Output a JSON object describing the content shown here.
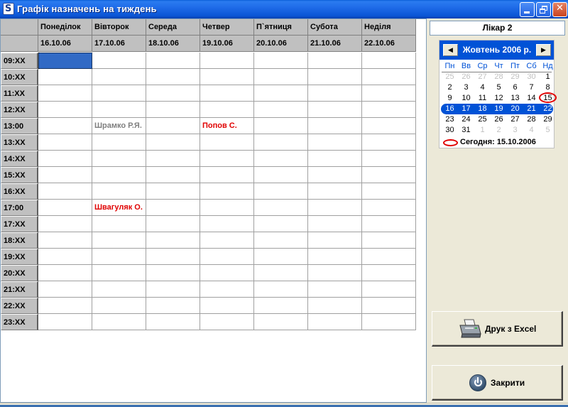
{
  "window": {
    "title": "Графік назначень на тиждень",
    "icon": "app-s-icon",
    "controls": [
      "minimize-icon",
      "restore-icon",
      "close-icon"
    ]
  },
  "grid": {
    "days": [
      {
        "name": "Понеділок",
        "date": "16.10.06"
      },
      {
        "name": "Вівторок",
        "date": "17.10.06"
      },
      {
        "name": "Середа",
        "date": "18.10.06"
      },
      {
        "name": "Четвер",
        "date": "19.10.06"
      },
      {
        "name": "П`ятниця",
        "date": "20.10.06"
      },
      {
        "name": "Субота",
        "date": "21.10.06"
      },
      {
        "name": "Неділя",
        "date": "22.10.06"
      }
    ],
    "times": [
      "09:XX",
      "10:XX",
      "11:XX",
      "12:XX",
      "13:00",
      "13:XX",
      "14:XX",
      "15:XX",
      "16:XX",
      "17:00",
      "17:XX",
      "18:XX",
      "19:XX",
      "20:XX",
      "21:XX",
      "22:XX",
      "23:XX"
    ],
    "appointments": [
      {
        "row": 4,
        "col": 1,
        "text": "Шрамко Р.Я.",
        "color": "gray"
      },
      {
        "row": 4,
        "col": 3,
        "text": "Попов С.",
        "color": "red"
      },
      {
        "row": 9,
        "col": 1,
        "text": "Швагуляк О.",
        "color": "red"
      }
    ],
    "selected": {
      "row": 0,
      "col": 0
    }
  },
  "doctor": {
    "label": "Лікар 2"
  },
  "calendar": {
    "month_label": "Жовтень 2006 р.",
    "weekdays": [
      "Пн",
      "Вв",
      "Ср",
      "Чт",
      "Пт",
      "Сб",
      "Нд"
    ],
    "weeks": [
      [
        [
          "25",
          "other"
        ],
        [
          "26",
          "other"
        ],
        [
          "27",
          "other"
        ],
        [
          "28",
          "other"
        ],
        [
          "29",
          "other"
        ],
        [
          "30",
          "other"
        ],
        [
          "1",
          ""
        ]
      ],
      [
        [
          "2",
          ""
        ],
        [
          "3",
          ""
        ],
        [
          "4",
          ""
        ],
        [
          "5",
          ""
        ],
        [
          "6",
          ""
        ],
        [
          "7",
          ""
        ],
        [
          "8",
          ""
        ]
      ],
      [
        [
          "9",
          ""
        ],
        [
          "10",
          ""
        ],
        [
          "11",
          ""
        ],
        [
          "12",
          ""
        ],
        [
          "13",
          ""
        ],
        [
          "14",
          ""
        ],
        [
          "15",
          "today"
        ]
      ],
      [
        [
          "16",
          "hl"
        ],
        [
          "17",
          "hl"
        ],
        [
          "18",
          "hl"
        ],
        [
          "19",
          "hl"
        ],
        [
          "20",
          "hl"
        ],
        [
          "21",
          "hl"
        ],
        [
          "22",
          "hl"
        ]
      ],
      [
        [
          "23",
          ""
        ],
        [
          "24",
          ""
        ],
        [
          "25",
          ""
        ],
        [
          "26",
          ""
        ],
        [
          "27",
          ""
        ],
        [
          "28",
          ""
        ],
        [
          "29",
          ""
        ]
      ],
      [
        [
          "30",
          ""
        ],
        [
          "31",
          ""
        ],
        [
          "1",
          "other"
        ],
        [
          "2",
          "other"
        ],
        [
          "3",
          "other"
        ],
        [
          "4",
          "other"
        ],
        [
          "5",
          "other"
        ]
      ]
    ],
    "today_label": "Сегодня: 15.10.2006",
    "prev_icon": "arrow-left-icon",
    "next_icon": "arrow-right-icon"
  },
  "buttons": {
    "excel": {
      "label": "Друк з Excel",
      "icon": "printer-icon"
    },
    "close": {
      "label": "Закрити",
      "icon": "power-icon"
    }
  },
  "colors": {
    "title_bar": "#0a56d6",
    "calendar_header": "#0052d6",
    "selection": "#316ac5",
    "appointment_red": "#e00000",
    "appointment_gray": "#808080"
  }
}
